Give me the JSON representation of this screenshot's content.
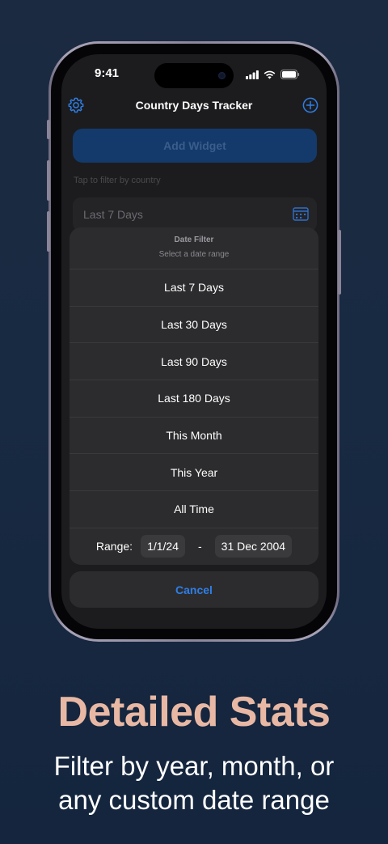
{
  "status_bar": {
    "time": "9:41"
  },
  "nav": {
    "title": "Country Days Tracker",
    "settings_icon": "gear-icon",
    "add_icon": "plus-circle-icon"
  },
  "main": {
    "add_widget_label": "Add Widget",
    "filter_hint": "Tap to filter by country",
    "date_field_value": "Last 7 Days"
  },
  "sheet": {
    "title": "Date Filter",
    "subtitle": "Select a date range",
    "options": [
      "Last 7 Days",
      "Last 30 Days",
      "Last 90 Days",
      "Last 180 Days",
      "This Month",
      "This Year",
      "All Time"
    ],
    "range_label": "Range:",
    "range_start": "1/1/24",
    "range_separator": "-",
    "range_end": "31 Dec 2004",
    "cancel_label": "Cancel"
  },
  "marketing": {
    "headline": "Detailed Stats",
    "subline_1": "Filter by year, month, or",
    "subline_2": "any custom date range"
  },
  "colors": {
    "accent": "#2f7ee6",
    "headline": "#e8b8a4",
    "background": "#182a42"
  }
}
